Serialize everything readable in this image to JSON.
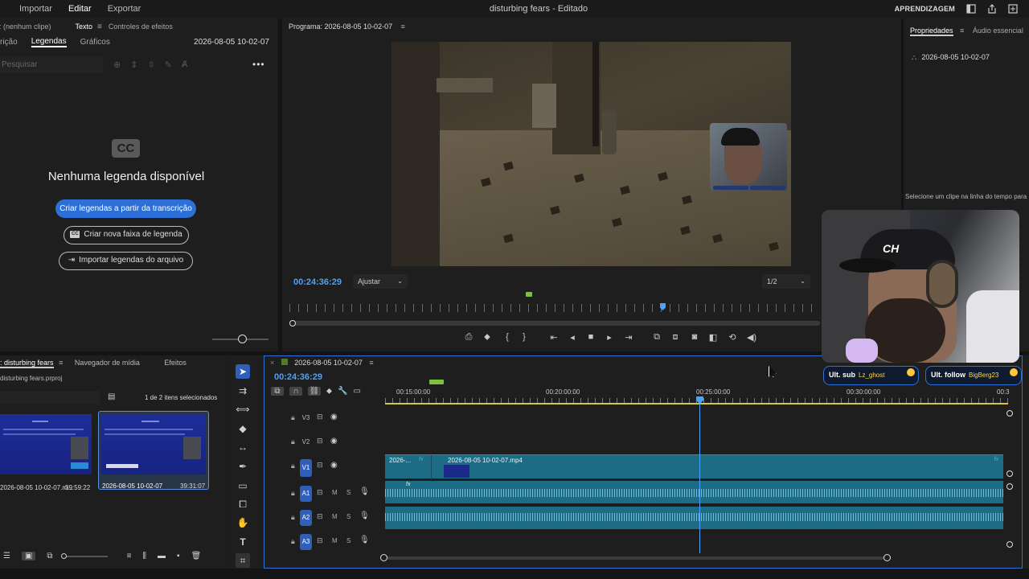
{
  "menubar": {
    "tabs": [
      "Importar",
      "Editar",
      "Exportar"
    ],
    "active_tab": "Editar",
    "title": "disturbing fears - Editado",
    "learn": "APRENDIZAGEM"
  },
  "left_panel": {
    "clip_label": ": (nenhum clipe)",
    "tab_texto": "Texto",
    "tab_effects": "Controles de efeitos",
    "subtab_transcricao": "rição",
    "subtab_legendas": "Legendas",
    "subtab_graficos": "Gráficos",
    "sequence_name": "2026-08-05 10-02-07",
    "search_placeholder": "Pesquisar",
    "cc_badge": "CC",
    "no_captions": "Nenhuma legenda disponível",
    "btn_create_from_transcript": "Criar legendas a partir da transcrição",
    "btn_new_track": "Criar nova faixa de legenda",
    "btn_import": "Importar legendas do arquivo"
  },
  "program": {
    "title": "Programa: 2026-08-05 10-02-07",
    "timecode": "00:24:36:29",
    "fit_label": "Ajustar",
    "resolution": "1/2"
  },
  "properties": {
    "tab_props": "Propriedades",
    "tab_audio": "Áudio essencial",
    "sequence_name": "2026-08-05 10-02-07",
    "hint": "Selecione um clipe na linha do tempo para"
  },
  "overlay": {
    "cap_logo": "CH",
    "sub_label": "Ult. sub",
    "sub_user": "Lz_ghost",
    "follow_label": "Ult. follow",
    "follow_user": "BigBerg23"
  },
  "project": {
    "tab_project": ": disturbing fears",
    "tab_media": "Navegador de mídia",
    "tab_effects": "Efeitos",
    "file": "disturbing fears.prproj",
    "selection": "1 de 2 itens selecionados",
    "items": [
      {
        "name": "2026-08-05 10-02-07.m...",
        "duration": "39:59:22"
      },
      {
        "name": "2026-08-05 10-02-07",
        "duration": "39:31:07"
      }
    ]
  },
  "timeline": {
    "sequence_name": "2026-08-05 10-02-07",
    "timecode": "00:24:36:29",
    "ruler_labels": [
      "00:15:00:00",
      "00:20:00:00",
      "00:25:00:00",
      "00:30:00:00",
      "00:3"
    ],
    "tracks": {
      "v3": "V3",
      "v2": "V2",
      "v1": "V1",
      "a1": "A1",
      "a2": "A2",
      "a3": "A3",
      "mute": "M",
      "solo": "S"
    },
    "clip_short": "2026-...",
    "clip_name": "2026-08-05 10-02-07.mp4",
    "fx": "fx"
  }
}
